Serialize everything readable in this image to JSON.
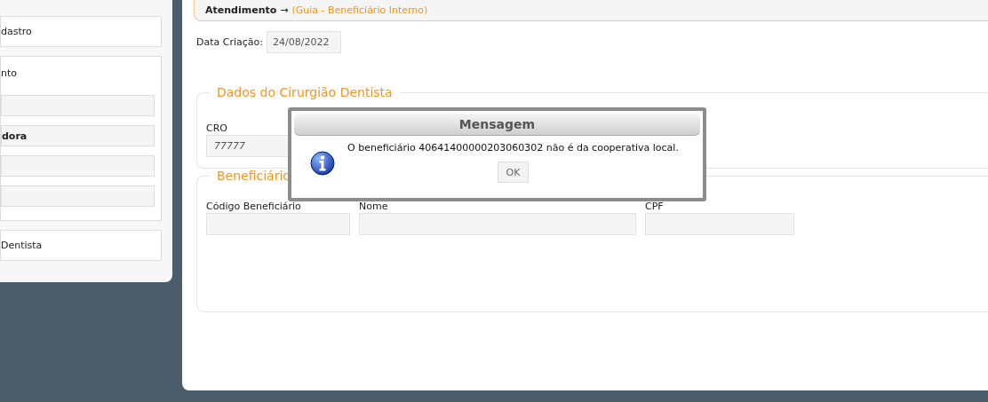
{
  "sidebar": {
    "items": [
      {
        "kind": "item",
        "label": "dastro"
      },
      {
        "kind": "group",
        "label": "nto",
        "fields": [
          {
            "kind": "blank"
          },
          {
            "kind": "text",
            "value": "dora"
          },
          {
            "kind": "blank"
          },
          {
            "kind": "blank"
          }
        ]
      },
      {
        "kind": "item",
        "label": "Dentista"
      }
    ]
  },
  "breadcrumb": {
    "section": "Atendimento",
    "arrow": "→",
    "page": "(Guia - Beneficiário Interno)"
  },
  "creation_date": {
    "label": "Data Criação:",
    "value": "24/08/2022"
  },
  "dentist": {
    "legend": "Dados do Cirurgião Dentista",
    "cro": {
      "label": "CRO",
      "value": "77777"
    }
  },
  "beneficiary": {
    "legend": "Beneficiário",
    "fields": [
      {
        "label": "Código Beneficiário"
      },
      {
        "label": "Nome"
      },
      {
        "label": "CPF"
      }
    ]
  },
  "dialog": {
    "title": "Mensagem",
    "message": "O beneficiário 40641400000203060302 não é da cooperativa local.",
    "button": "OK"
  }
}
